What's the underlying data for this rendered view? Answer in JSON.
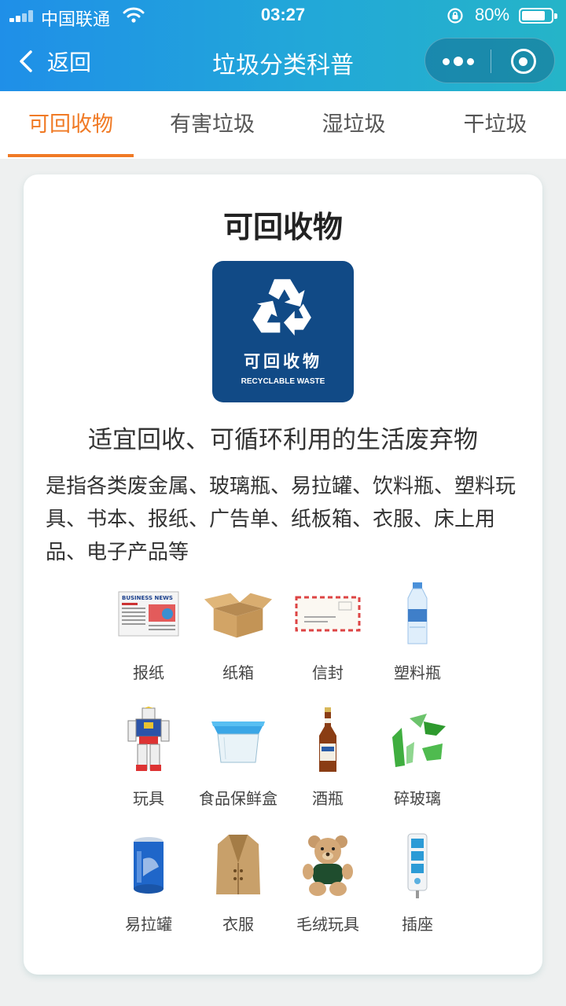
{
  "status_bar": {
    "carrier": "中国联通",
    "time": "03:27",
    "battery_percent": "80%",
    "battery_level": 0.8
  },
  "nav": {
    "back_label": "返回",
    "title": "垃圾分类科普"
  },
  "tabs": [
    {
      "label": "可回收物",
      "active": true
    },
    {
      "label": "有害垃圾",
      "active": false
    },
    {
      "label": "湿垃圾",
      "active": false
    },
    {
      "label": "干垃圾",
      "active": false
    }
  ],
  "card": {
    "title": "可回收物",
    "sign": {
      "label_cn": "可回收物",
      "label_en": "RECYCLABLE WASTE",
      "icon": "recycle-icon",
      "color": "#114a86"
    },
    "subtitle": "适宜回收、可循环利用的生活废弃物",
    "description": "是指各类废金属、玻璃瓶、易拉罐、饮料瓶、塑料玩具、书本、报纸、广告单、纸板箱、衣服、床上用品、电子产品等",
    "items": [
      {
        "label": "报纸",
        "icon": "newspaper-icon",
        "printed_text": "BUSINESS NEWS"
      },
      {
        "label": "纸箱",
        "icon": "cardboard-box-icon"
      },
      {
        "label": "信封",
        "icon": "envelope-icon"
      },
      {
        "label": "塑料瓶",
        "icon": "plastic-bottle-icon"
      },
      {
        "label": "玩具",
        "icon": "robot-toy-icon"
      },
      {
        "label": "食品保鲜盒",
        "icon": "food-container-icon"
      },
      {
        "label": "酒瓶",
        "icon": "beer-bottle-icon"
      },
      {
        "label": "碎玻璃",
        "icon": "broken-glass-icon"
      },
      {
        "label": "易拉罐",
        "icon": "soda-can-icon"
      },
      {
        "label": "衣服",
        "icon": "coat-icon"
      },
      {
        "label": "毛绒玩具",
        "icon": "teddy-bear-icon"
      },
      {
        "label": "插座",
        "icon": "power-strip-icon"
      }
    ]
  },
  "colors": {
    "accent": "#f07a25",
    "header_start": "#1f8fe8",
    "header_end": "#25b4c8"
  }
}
